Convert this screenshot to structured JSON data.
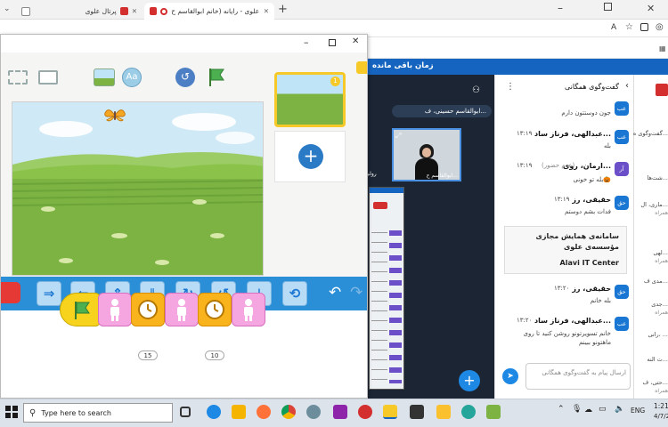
{
  "browser": {
    "tabs": [
      {
        "label": "پرتال علوی"
      },
      {
        "label": "علوی - رایانه (خانم ابوالقاسم ح..."
      }
    ],
    "new_tab": "+"
  },
  "meeting": {
    "topbar_text": "زمان باقی مانده",
    "participant_chip": "ابوالقاسم حسینی، ف...",
    "video_label": "ابوالقاسم ح...",
    "video_label_left": "رولی"
  },
  "chat": {
    "header": "گفت‌وگوی همگانی",
    "partial_text": "جون دوستتون دارم",
    "messages": [
      {
        "avatar": "عب",
        "name": "عبدالهی، فرناز ساد...",
        "time": "۱۳:۱۹",
        "text": "بله"
      },
      {
        "avatar": "آر",
        "name": "ارمان، روی...",
        "time": "۱۳:۱۹",
        "status": "(عدم حضور)",
        "text": "بله تو خونی🎃"
      },
      {
        "avatar": "حق",
        "name": "حقیقی، رز",
        "time": "۱۳:۱۹",
        "text": "فدات بشم دوستم"
      },
      {
        "avatar": "حق",
        "name": "حقیقی، رز",
        "time": "۱۳:۲۰",
        "text": "بله خانم"
      },
      {
        "avatar": "عب",
        "name": "عبدالهی، فرناز ساد...",
        "time": "۱۳:۲۰",
        "text": "خانم تسویرتونو روشن کنید تا روی ماهتونو ببینم"
      }
    ],
    "banner": {
      "title": "سامانه‌ی همایش مجازی",
      "subtitle": "مؤسسه‌ی علوی",
      "brand": "Alavi IT Center"
    },
    "input_placeholder": "ارسال پیام به گفت‌وگوی همگانی",
    "right_items": [
      "گفت‌وگوی ه...",
      "شت‌ها...",
      "ماری، ال...",
      "همراه",
      "لهی...",
      "همراه",
      "مدی ف...",
      "جدی...",
      "همراه",
      "رانی، ...",
      "ت النه...",
      "حتی، ف...",
      "همراه"
    ]
  },
  "scratchjr": {
    "page_badge": "1",
    "add_page": "+",
    "wait_block_1": "15",
    "wait_block_2": "10"
  },
  "taskbar": {
    "search_placeholder": "Type here to search",
    "language": "ENG",
    "time": "1:21",
    "date": "4/7/2"
  },
  "colors": {
    "meeting_blue": "#1565c0",
    "palette_blue": "#2a8fd6",
    "sky": "#cfe9f6",
    "grass": "#7cb342",
    "motion_block": "#b9dcf6",
    "control_block": "#f9b31c",
    "looks_block": "#f5a5e0",
    "flag_yellow": "#f7d31e"
  }
}
